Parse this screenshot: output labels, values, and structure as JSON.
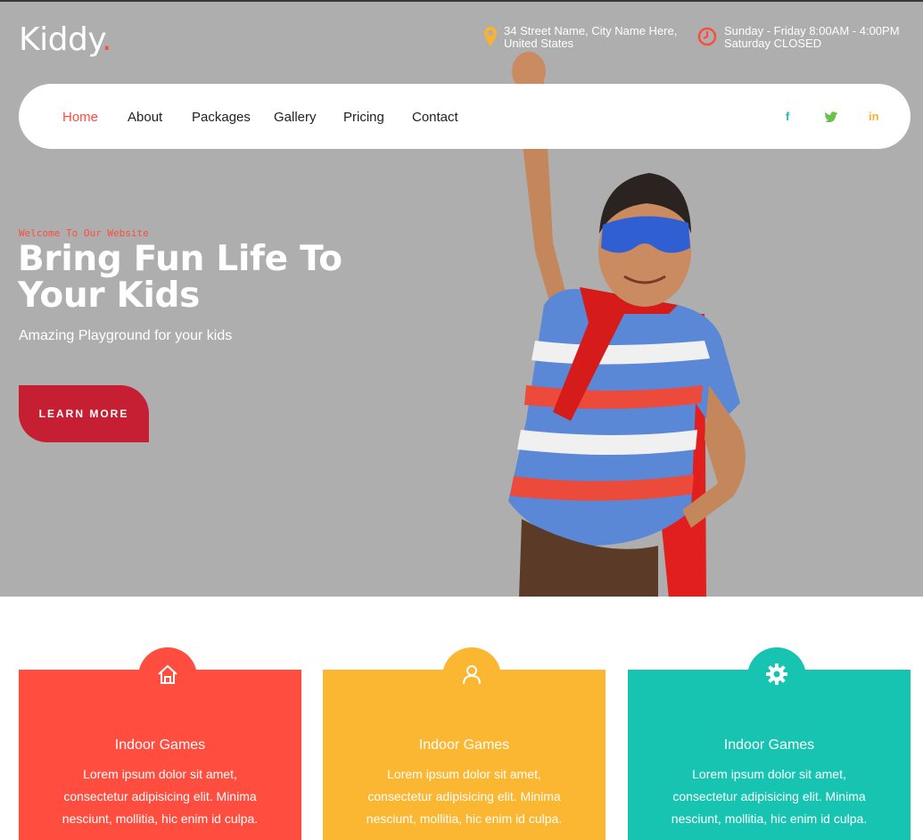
{
  "brand": {
    "name": "Kiddy",
    "dot": "."
  },
  "contact": {
    "address": [
      "34 Street Name, City Name Here,",
      "United States"
    ],
    "hours": [
      "Sunday - Friday 8:00AM - 4:00PM",
      "Saturday CLOSED"
    ]
  },
  "nav": {
    "items": [
      {
        "label": "Home",
        "active": true
      },
      {
        "label": "About"
      },
      {
        "label": "Packages"
      },
      {
        "label": "Gallery"
      },
      {
        "label": "Pricing"
      },
      {
        "label": "Contact"
      }
    ],
    "social": [
      {
        "label": "f",
        "icon": "facebook-icon",
        "color": "#1bbfb0"
      },
      {
        "label": "t",
        "icon": "twitter-icon",
        "color": "#6cbf4a"
      },
      {
        "label": "in",
        "icon": "linkedin-icon",
        "color": "#f8b332"
      }
    ]
  },
  "hero": {
    "eyebrow": "Welcome To Our Website",
    "title_line1": "Bring Fun Life To",
    "title_line2": "Your Kids",
    "subtitle": "Amazing Playground for your kids",
    "cta": "LEARN MORE"
  },
  "cards": [
    {
      "icon": "home-icon",
      "color": "#ff4d40",
      "title": "Indoor Games",
      "text": [
        "Lorem ipsum dolor sit amet,",
        "consectetur adipisicing elit. Minima",
        "nesciunt, mollitia, hic enim id culpa."
      ]
    },
    {
      "icon": "user-icon",
      "color": "#fbb632",
      "title": "Indoor Games",
      "text": [
        "Lorem ipsum dolor sit amet,",
        "consectetur adipisicing elit. Minima",
        "nesciunt, mollitia, hic enim id culpa."
      ]
    },
    {
      "icon": "gear-icon",
      "color": "#16c4b1",
      "title": "Indoor Games",
      "text": [
        "Lorem ipsum dolor sit amet,",
        "consectetur adipisicing elit. Minima",
        "nesciunt, mollitia, hic enim id culpa."
      ]
    }
  ],
  "colors": {
    "accent": "#ff4b3e",
    "cta": "#c61f33",
    "hero_bg": "#aeaeae"
  }
}
